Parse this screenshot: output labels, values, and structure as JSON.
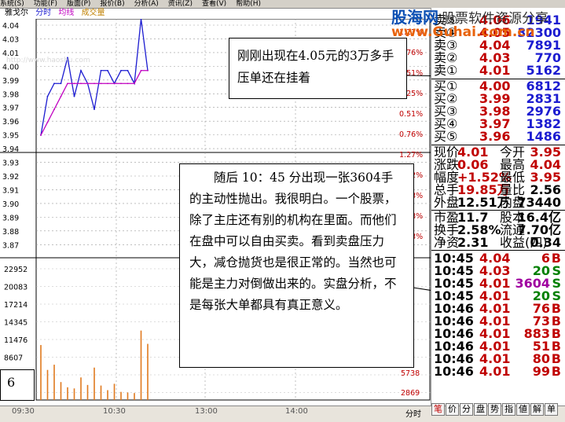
{
  "menubar": [
    "系统(S)",
    "功能(F)",
    "版面(P)",
    "报价(B)",
    "分析(A)",
    "资讯(Z)",
    "查看(V)",
    "帮助(H)"
  ],
  "chart_header": {
    "name": "雅戈尔",
    "mode": "分时",
    "avg_label": "均线",
    "vol_label": "成交量"
  },
  "watermark": {
    "logo": "股海网",
    "tagline": "股票软件资源分享",
    "url": "www.Guhai.com.cn",
    "faint_url": "http://www.haoshu.com"
  },
  "price_axis": [
    "4.04",
    "4.03",
    "4.01",
    "4.00",
    "3.99",
    "3.98",
    "3.97",
    "3.96",
    "3.95",
    "3.94",
    "3.93",
    "3.92",
    "3.91",
    "3.90",
    "3.89",
    "3.88",
    "3.87"
  ],
  "pct_axis": [
    "1.27%",
    "0.76%",
    "0.51%",
    "0.25%",
    "0.51%",
    "0.76%",
    "1.27%",
    "1.52%",
    "2.03%",
    "2.28%",
    "2.53%"
  ],
  "volume_axis": [
    "22952",
    "20083",
    "17214",
    "14345",
    "11476",
    "8607",
    "5738",
    "2869"
  ],
  "volume_axis_right": [
    "5738",
    "2869"
  ],
  "time_axis": [
    "09:30",
    "10:30",
    "13:00",
    "14:00",
    "分时"
  ],
  "chart_data": {
    "type": "line",
    "x": [
      "09:30",
      "09:35",
      "09:40",
      "09:45",
      "09:50",
      "09:55",
      "10:00",
      "10:05",
      "10:10",
      "10:15",
      "10:20",
      "10:25",
      "10:30",
      "10:35",
      "10:40",
      "10:45",
      "10:46"
    ],
    "series": [
      {
        "values": [
          3.96,
          3.99,
          4.0,
          4.0,
          4.02,
          3.99,
          4.01,
          4.0,
          3.98,
          4.01,
          4.01,
          4.0,
          4.01,
          4.01,
          4.0,
          4.05,
          4.01
        ]
      },
      {
        "values": [
          3.96,
          3.97,
          3.98,
          3.99,
          4.0,
          4.0,
          4.0,
          4.0,
          4.0,
          4.0,
          4.0,
          4.0,
          4.0,
          4.0,
          4.0,
          4.01,
          4.01
        ]
      }
    ],
    "volume": [
      9500,
      5200,
      6100,
      3100,
      2200,
      2000,
      3900,
      2600,
      5600,
      2500,
      1700,
      2800,
      1400,
      1300,
      1200,
      12000,
      9700
    ],
    "ylim": [
      3.87,
      4.05
    ],
    "volume_max": 22952
  },
  "order_book": {
    "sell": [
      {
        "label": "卖⑤",
        "price": "4.06",
        "vol": "1941"
      },
      {
        "label": "卖④",
        "price": "4.05",
        "vol": "32300"
      },
      {
        "label": "卖③",
        "price": "4.04",
        "vol": "7891"
      },
      {
        "label": "卖②",
        "price": "4.03",
        "vol": "770"
      },
      {
        "label": "卖①",
        "price": "4.01",
        "vol": "5162"
      }
    ],
    "buy": [
      {
        "label": "买①",
        "price": "4.00",
        "vol": "6812"
      },
      {
        "label": "买②",
        "price": "3.99",
        "vol": "2831"
      },
      {
        "label": "买③",
        "price": "3.98",
        "vol": "2976"
      },
      {
        "label": "买④",
        "price": "3.97",
        "vol": "1382"
      },
      {
        "label": "买⑤",
        "price": "3.96",
        "vol": "1486"
      }
    ]
  },
  "quote": [
    {
      "k1": "现价",
      "v1": "4.01",
      "k2": "今开",
      "v2": "3.95"
    },
    {
      "k1": "涨跌",
      "v1": "0.06",
      "k2": "最高",
      "v2": "4.04"
    },
    {
      "k1": "幅度",
      "v1": "+1.52%",
      "k2": "最低",
      "v2": "3.95"
    },
    {
      "k1": "总手",
      "v1": "19.85万",
      "k2": "量比",
      "v2": "2.56"
    },
    {
      "k1": "外盘",
      "v1": "12.51万",
      "k2": "内盘",
      "v2": "73440"
    },
    {
      "k1": "市盈",
      "v1": "11.7",
      "k2": "股本",
      "v2": "16.4亿"
    },
    {
      "k1": "换手",
      "v1": "2.58%",
      "k2": "流通",
      "v2": "7.70亿"
    },
    {
      "k1": "净资",
      "v1": "2.31",
      "k2": "收益(四)",
      "v2": "0.34"
    }
  ],
  "trades": [
    {
      "time": "10:45",
      "price": "4.04",
      "vol": "6",
      "side": "B"
    },
    {
      "time": "10:45",
      "price": "4.03",
      "vol": "20",
      "side": "S"
    },
    {
      "time": "10:45",
      "price": "4.01",
      "vol": "3604",
      "side": "S"
    },
    {
      "time": "10:45",
      "price": "4.01",
      "vol": "20",
      "side": "S"
    },
    {
      "time": "10:46",
      "price": "4.01",
      "vol": "76",
      "side": "B"
    },
    {
      "time": "10:46",
      "price": "4.01",
      "vol": "73",
      "side": "B"
    },
    {
      "time": "10:46",
      "price": "4.01",
      "vol": "883",
      "side": "B"
    },
    {
      "time": "10:46",
      "price": "4.01",
      "vol": "51",
      "side": "B"
    },
    {
      "time": "10:46",
      "price": "4.01",
      "vol": "80",
      "side": "B"
    },
    {
      "time": "10:46",
      "price": "4.01",
      "vol": "99",
      "side": "B"
    }
  ],
  "tabs": [
    "笔",
    "价",
    "分",
    "盘",
    "势",
    "指",
    "値",
    "解",
    "单"
  ],
  "annotation_top": "刚刚出现在4.05元的3万多手压单还在挂着",
  "annotation_mid": "随后 10：45 分出现一张3604手的主动性抛出。我很明白。一个股票，除了主庄还有别的机构在里面。而他们在盘中可以自由买卖。看到卖盘压力大，减仓抛货也是很正常的。当然也可能是主力对倒做出来的。实盘分析，不是每张大单都具有真正意义。",
  "page_number": "6"
}
